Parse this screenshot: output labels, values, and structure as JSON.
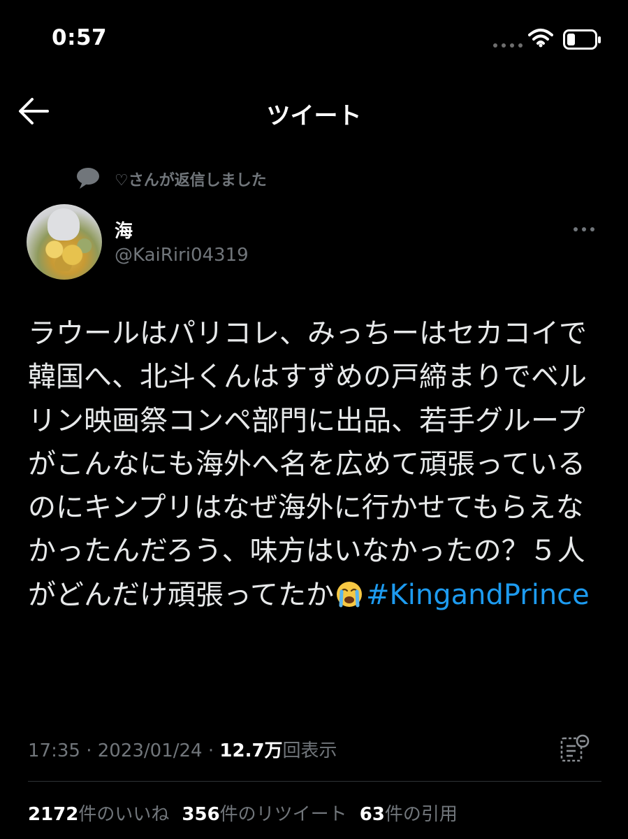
{
  "status_bar": {
    "time": "0:57"
  },
  "header": {
    "title": "ツイート"
  },
  "reply_context": {
    "text": "♡さんが返信しました"
  },
  "author": {
    "display_name": "海",
    "handle": "@KaiRiri04319"
  },
  "tweet": {
    "text": "ラウールはパリコレ、みっちーはセカコイで韓国へ、北斗くんはすずめの戸締まりでベルリン映画祭コンペ部門に出品、若手グループがこんなにも海外へ名を広めて頑張っているのにキンプリはなぜ海外に行かせてもらえなかったんだろう、味方はいなかったの？５人がどんだけ頑張ってたか",
    "emoji": "loudly-crying-face",
    "hashtag": "#KingandPrince"
  },
  "meta": {
    "time": "17:35",
    "separator": "·",
    "date": "2023/01/24",
    "views_value": "12.7万",
    "views_label": "回表示"
  },
  "stats": {
    "likes_value": "2172",
    "likes_label": "件のいいね",
    "retweets_value": "356",
    "retweets_label": "件のリツイート",
    "quotes_value": "63",
    "quotes_label": "件の引用"
  },
  "colors": {
    "background": "#000000",
    "text": "#e7e9ea",
    "secondary": "#71767b",
    "link": "#1d9bf0",
    "divider": "#2f3336"
  }
}
